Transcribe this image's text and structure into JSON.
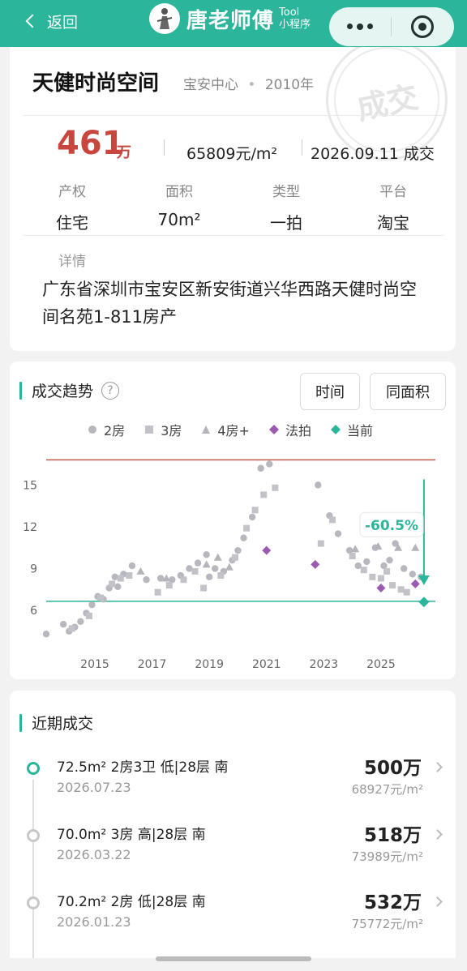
{
  "nav": {
    "back_label": "返回",
    "brand_name": "唐老师傅",
    "brand_tag_1": "Tool",
    "brand_tag_2": "小程序"
  },
  "property": {
    "name": "天健时尚空间",
    "district": "宝安中心",
    "year": "2010年",
    "stamp": "成交",
    "price": "461",
    "price_unit": "万",
    "unit_price": "65809元/m²",
    "deal_date": "2026.09.11 成交",
    "attributes": [
      {
        "label": "产权",
        "value": "住宅"
      },
      {
        "label": "面积",
        "value": "70m²"
      },
      {
        "label": "类型",
        "value": "一拍"
      },
      {
        "label": "平台",
        "value": "淘宝"
      }
    ],
    "detail_label": "详情",
    "detail": "广东省深圳市宝安区新安街道兴华西路天健时尚空间名苑1-811房产"
  },
  "trend": {
    "title": "成交趋势",
    "help_icon": "question-icon",
    "buttons": [
      "时间",
      "同面积"
    ],
    "legend": [
      "2房",
      "3房",
      "4房+",
      "法拍",
      "当前"
    ]
  },
  "chart_data": {
    "type": "scatter",
    "x_ticks": [
      "2015",
      "2017",
      "2019",
      "2021",
      "2023",
      "2025"
    ],
    "y_ticks": [
      6,
      9,
      12,
      15
    ],
    "ylim": [
      3.5,
      17
    ],
    "xlim": [
      2013.3,
      2026.9
    ],
    "reference_lines": {
      "peak": 16.8,
      "current": 6.65
    },
    "change_label": "-60.5%",
    "colors": {
      "two_room": "#b7b8bf",
      "three_room": "#c2c3c9",
      "four_room": "#b4b5bb",
      "auction": "#9b5bb3",
      "current": "#2bb59a",
      "peak_line": "#c0584e",
      "current_line": "#2bb59a"
    },
    "series": [
      {
        "name": "2房",
        "marker": "circle",
        "points": [
          [
            2013.3,
            4.3
          ],
          [
            2013.9,
            5
          ],
          [
            2014.1,
            4.5
          ],
          [
            2014.3,
            4.8
          ],
          [
            2014.5,
            5.2
          ],
          [
            2014.7,
            5.8
          ],
          [
            2014.9,
            6.4
          ],
          [
            2015.1,
            7
          ],
          [
            2015.3,
            6.8
          ],
          [
            2015.5,
            7.6
          ],
          [
            2015.7,
            8.4
          ],
          [
            2015.8,
            7.7
          ],
          [
            2016,
            8.6
          ],
          [
            2016.3,
            9.2
          ],
          [
            2016.8,
            8.2
          ],
          [
            2017.3,
            8.3
          ],
          [
            2017.7,
            8.2
          ],
          [
            2018,
            8.5
          ],
          [
            2018.3,
            9
          ],
          [
            2018.6,
            9.4
          ],
          [
            2018.9,
            10
          ],
          [
            2019,
            8.4
          ],
          [
            2019.2,
            9
          ],
          [
            2019.5,
            8.8
          ],
          [
            2019.8,
            9.6
          ],
          [
            2020,
            10.3
          ],
          [
            2020.2,
            11.2
          ],
          [
            2020.5,
            12.7
          ],
          [
            2020.8,
            16.2
          ],
          [
            2021.1,
            16.5
          ],
          [
            2022.8,
            15
          ],
          [
            2023.2,
            12.8
          ],
          [
            2023.5,
            11.5
          ],
          [
            2023.9,
            10.3
          ],
          [
            2024.2,
            9.2
          ],
          [
            2024.5,
            9.5
          ],
          [
            2024.8,
            10.5
          ],
          [
            2025.1,
            9.2
          ],
          [
            2025.3,
            9.6
          ],
          [
            2025.5,
            10.8
          ],
          [
            2025.8,
            9
          ],
          [
            2026.1,
            8.6
          ],
          [
            2026.4,
            8.4
          ]
        ]
      },
      {
        "name": "3房",
        "marker": "square",
        "points": [
          [
            2014.2,
            4.7
          ],
          [
            2014.8,
            5.6
          ],
          [
            2015.2,
            6.9
          ],
          [
            2015.6,
            7.9
          ],
          [
            2015.9,
            8.3
          ],
          [
            2016.2,
            8.5
          ],
          [
            2017.2,
            7.3
          ],
          [
            2017.6,
            7.8
          ],
          [
            2018.1,
            8.2
          ],
          [
            2018.5,
            8.8
          ],
          [
            2018.8,
            7.6
          ],
          [
            2019.4,
            8.5
          ],
          [
            2019.9,
            9.8
          ],
          [
            2020.3,
            11.9
          ],
          [
            2020.6,
            13.2
          ],
          [
            2020.9,
            14.3
          ],
          [
            2021.3,
            14.8
          ],
          [
            2022.9,
            10.8
          ],
          [
            2023.3,
            12.5
          ],
          [
            2024,
            9.9
          ],
          [
            2024.4,
            8.9
          ],
          [
            2024.7,
            8.4
          ],
          [
            2025,
            8.3
          ],
          [
            2025.2,
            8.8
          ],
          [
            2025.4,
            7.8
          ],
          [
            2025.7,
            7.5
          ],
          [
            2025.9,
            7.3
          ]
        ]
      },
      {
        "name": "4房+",
        "marker": "triangle",
        "points": [
          [
            2016.6,
            8.8
          ],
          [
            2017.5,
            8.3
          ],
          [
            2018.9,
            9.3
          ],
          [
            2019.3,
            9.8
          ],
          [
            2019.7,
            9.1
          ],
          [
            2024.1,
            10.4
          ],
          [
            2024.9,
            10.6
          ],
          [
            2025.6,
            10.5
          ],
          [
            2026.2,
            10.5
          ]
        ]
      },
      {
        "name": "法拍",
        "marker": "diamond",
        "points": [
          [
            2021,
            10.3
          ],
          [
            2022.7,
            9.3
          ],
          [
            2025,
            7.6
          ],
          [
            2026.2,
            7.9
          ]
        ]
      },
      {
        "name": "当前",
        "marker": "diamond",
        "points": [
          [
            2026.5,
            6.6
          ]
        ]
      }
    ]
  },
  "recent": {
    "title": "近期成交",
    "records": [
      {
        "area": "72.5m²",
        "layout": "2房3卫",
        "floor": "低|28层",
        "orientation": "南",
        "date": "2026.07.23",
        "total": "500万",
        "unit_price": "68927元/m²"
      },
      {
        "area": "70.0m²",
        "layout": "3房",
        "floor": "高|28层",
        "orientation": "南",
        "date": "2026.03.22",
        "total": "518万",
        "unit_price": "73989元/m²"
      },
      {
        "area": "70.2m²",
        "layout": "2房",
        "floor": "低|28层",
        "orientation": "南",
        "date": "2026.01.23",
        "total": "532万",
        "unit_price": "75772元/m²"
      }
    ]
  }
}
